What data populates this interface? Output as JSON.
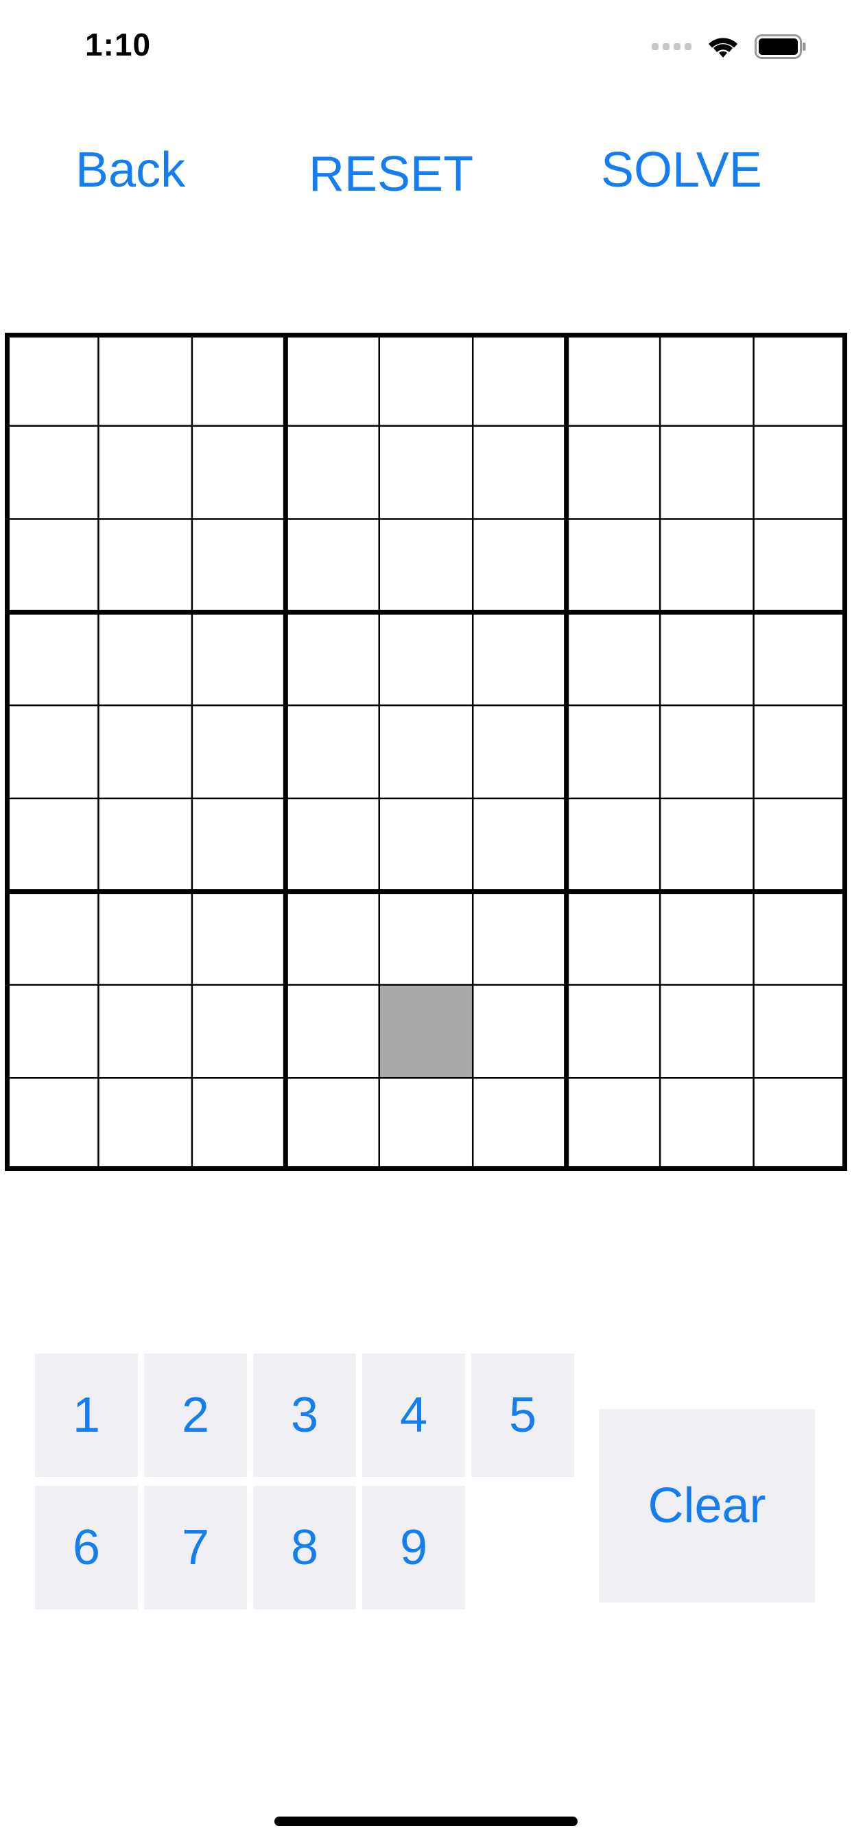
{
  "status_bar": {
    "time": "1:10",
    "icons": [
      "signal-icon",
      "wifi-icon",
      "battery-icon"
    ]
  },
  "nav": {
    "back_label": "Back",
    "reset_label": "RESET",
    "solve_label": "SOLVE"
  },
  "board": {
    "rows": 9,
    "cols": 9,
    "selected_cell": {
      "row": 8,
      "col": 5
    },
    "values": [
      [
        "",
        "",
        "",
        "",
        "",
        "",
        "",
        "",
        ""
      ],
      [
        "",
        "",
        "",
        "",
        "",
        "",
        "",
        "",
        ""
      ],
      [
        "",
        "",
        "",
        "",
        "",
        "",
        "",
        "",
        ""
      ],
      [
        "",
        "",
        "",
        "",
        "",
        "",
        "",
        "",
        ""
      ],
      [
        "",
        "",
        "",
        "",
        "",
        "",
        "",
        "",
        ""
      ],
      [
        "",
        "",
        "",
        "",
        "",
        "",
        "",
        "",
        ""
      ],
      [
        "",
        "",
        "",
        "",
        "",
        "",
        "",
        "",
        ""
      ],
      [
        "",
        "",
        "",
        "",
        "",
        "",
        "",
        "",
        ""
      ],
      [
        "",
        "",
        "",
        "",
        "",
        "",
        "",
        "",
        ""
      ]
    ]
  },
  "keypad": {
    "numbers": [
      "1",
      "2",
      "3",
      "4",
      "5",
      "6",
      "7",
      "8",
      "9"
    ],
    "clear_label": "Clear"
  },
  "colors": {
    "accent": "#147ef0",
    "button_bg": "#efeff4",
    "selected_cell": "#aaaaaa"
  }
}
